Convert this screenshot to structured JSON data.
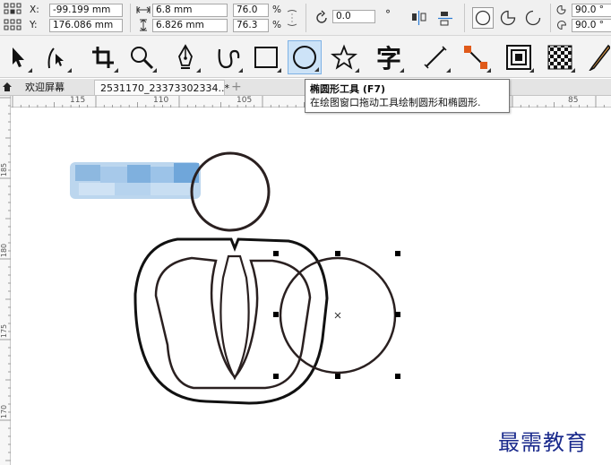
{
  "property_bar": {
    "x_label": "X:",
    "y_label": "Y:",
    "x_value": "-99.199 mm",
    "y_value": "176.086 mm",
    "width_value": "6.8 mm",
    "height_value": "6.826 mm",
    "scale_x_value": "76.0",
    "scale_y_value": "76.3",
    "percent_symbol": "%",
    "rotation_value": "0.0",
    "degree_symbol": "°",
    "start_angle_value": "90.0 °",
    "end_angle_value": "90.0 °"
  },
  "toolbox": {
    "tools": [
      {
        "name": "pick-tool",
        "icon": "arrow-pointer-icon"
      },
      {
        "name": "shape-tool",
        "icon": "node-edit-icon"
      },
      {
        "name": "crop-tool",
        "icon": "crop-icon"
      },
      {
        "name": "zoom-tool",
        "icon": "magnifier-icon"
      },
      {
        "name": "pen-tool",
        "icon": "pen-nib-icon"
      },
      {
        "name": "artistic-media-tool",
        "icon": "curve-brush-icon"
      },
      {
        "name": "rectangle-tool",
        "icon": "rectangle-icon"
      },
      {
        "name": "ellipse-tool",
        "icon": "ellipse-icon",
        "active": true
      },
      {
        "name": "polygon-tool",
        "icon": "star-icon"
      },
      {
        "name": "text-tool",
        "icon": "text-zi-icon",
        "glyph": "字"
      },
      {
        "name": "dimension-tool",
        "icon": "diagonal-line-icon"
      },
      {
        "name": "connector-tool",
        "icon": "connector-icon"
      },
      {
        "name": "contour-tool",
        "icon": "contour-square-icon"
      },
      {
        "name": "transparency-tool",
        "icon": "checkerboard-icon"
      },
      {
        "name": "eyedropper-tool",
        "icon": "pencil-icon"
      }
    ]
  },
  "tabs": {
    "welcome": "欢迎屏幕",
    "document": "2531170_23373302334..*",
    "add": "+"
  },
  "tooltip": {
    "title": "椭圆形工具 (F7)",
    "description": "在绘图窗口拖动工具绘制圆形和椭圆形."
  },
  "rulers": {
    "h_labels": [
      "115",
      "110",
      "105",
      "85"
    ],
    "v_labels": [
      "185",
      "180",
      "175",
      "170"
    ]
  },
  "watermark": "最需教育",
  "colors": {
    "accent": "#cde3f7",
    "ink": "#2a2020",
    "blur_patch": "#8fbbe0"
  }
}
